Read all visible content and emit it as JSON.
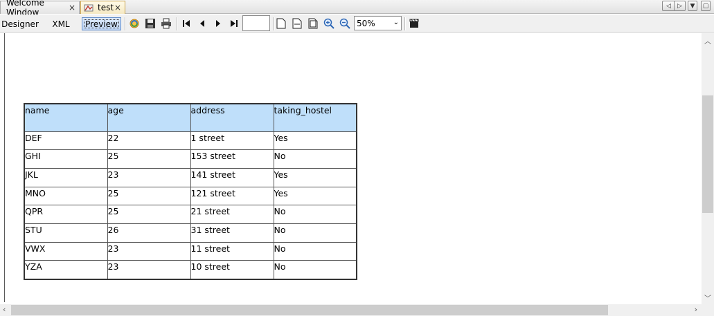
{
  "tabs": [
    {
      "label": "Welcome Window",
      "close": "×"
    },
    {
      "label": "test",
      "close": "×"
    }
  ],
  "toolbar": {
    "designer": "Designer",
    "xml": "XML",
    "preview": "Preview",
    "page_value": "",
    "zoom": "50%",
    "icons": [
      "refresh-icon",
      "save-icon",
      "print-icon",
      "first-page-icon",
      "prev-page-icon",
      "next-page-icon",
      "last-page-icon",
      "single-page-icon",
      "fit-width-icon",
      "fit-page-icon",
      "zoom-in-icon",
      "zoom-out-icon",
      "export-icon"
    ]
  },
  "report": {
    "headers": [
      "name",
      "age",
      "address",
      "taking_hostel"
    ],
    "rows": [
      [
        "DEF",
        "22",
        "1 street",
        "Yes"
      ],
      [
        "GHI",
        "25",
        "153 street",
        "No"
      ],
      [
        "JKL",
        "23",
        "141 street",
        "Yes"
      ],
      [
        "MNO",
        "25",
        "121 street",
        "Yes"
      ],
      [
        "QPR",
        "25",
        "21 street",
        "No"
      ],
      [
        "STU",
        "26",
        "31 street",
        "No"
      ],
      [
        "VWX",
        "23",
        "11 street",
        "No"
      ],
      [
        "YZA",
        "23",
        "10 street",
        "No"
      ]
    ]
  }
}
